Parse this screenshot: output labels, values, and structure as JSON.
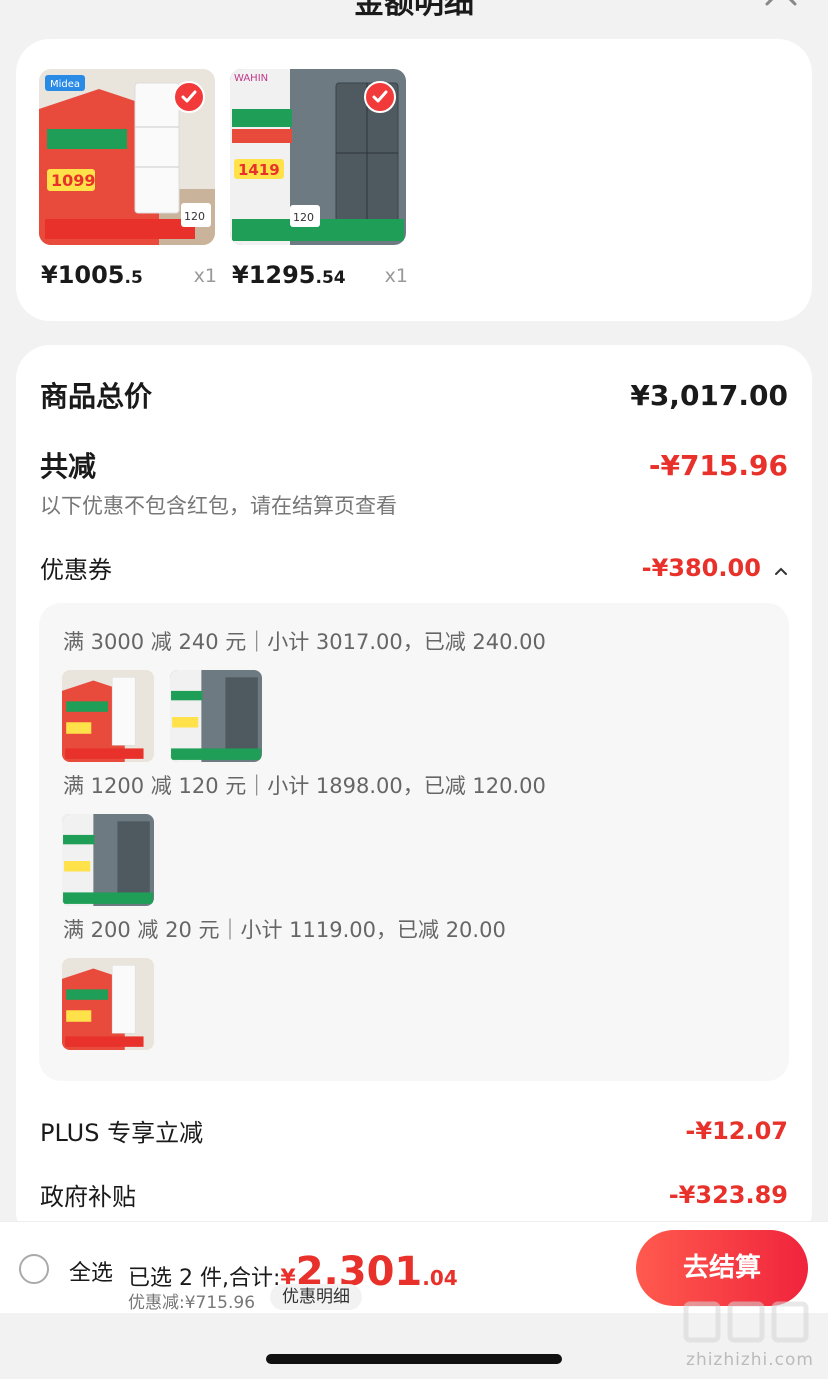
{
  "header": {
    "title": "金额明细"
  },
  "products": [
    {
      "brand": "Midea",
      "price_int": "¥1005",
      "price_dec": ".5",
      "qty": "x1",
      "selected": true
    },
    {
      "brand": "WAHIN",
      "price_int": "¥1295",
      "price_dec": ".54",
      "qty": "x1",
      "selected": true
    }
  ],
  "detail": {
    "total_label": "商品总价",
    "total_value": "¥3,017.00",
    "reduce_label": "共减",
    "reduce_value": "-¥715.96",
    "reduce_note": "以下优惠不包含红包，请在结算页查看",
    "coupon_label": "优惠券",
    "coupon_value": "-¥380.00",
    "coupons": [
      "满 3000 减 240 元｜小计 3017.00，已减 240.00",
      "满 1200 减 120 元｜小计 1898.00，已减 120.00",
      "满 200 减 20 元｜小计 1119.00，已减 20.00"
    ],
    "plus_label": "PLUS 专享立减",
    "plus_value": "-¥12.07",
    "gov_label": "政府补贴",
    "gov_value": "-¥323.89"
  },
  "bottom": {
    "select_all": "全选",
    "summary_prefix": "已选 2 件,合计:",
    "total_sym": "¥",
    "total_int": "2,301",
    "total_dec": ".04",
    "discount_line": "优惠减:¥715.96",
    "discount_detail_btn": "优惠明细",
    "checkout_btn": "去结算"
  },
  "watermark": {
    "text": "zhizhizhi.com"
  },
  "colors": {
    "accent_red": "#e8312a",
    "button_gradient": [
      "#ff5a4e",
      "#f0243c"
    ]
  }
}
